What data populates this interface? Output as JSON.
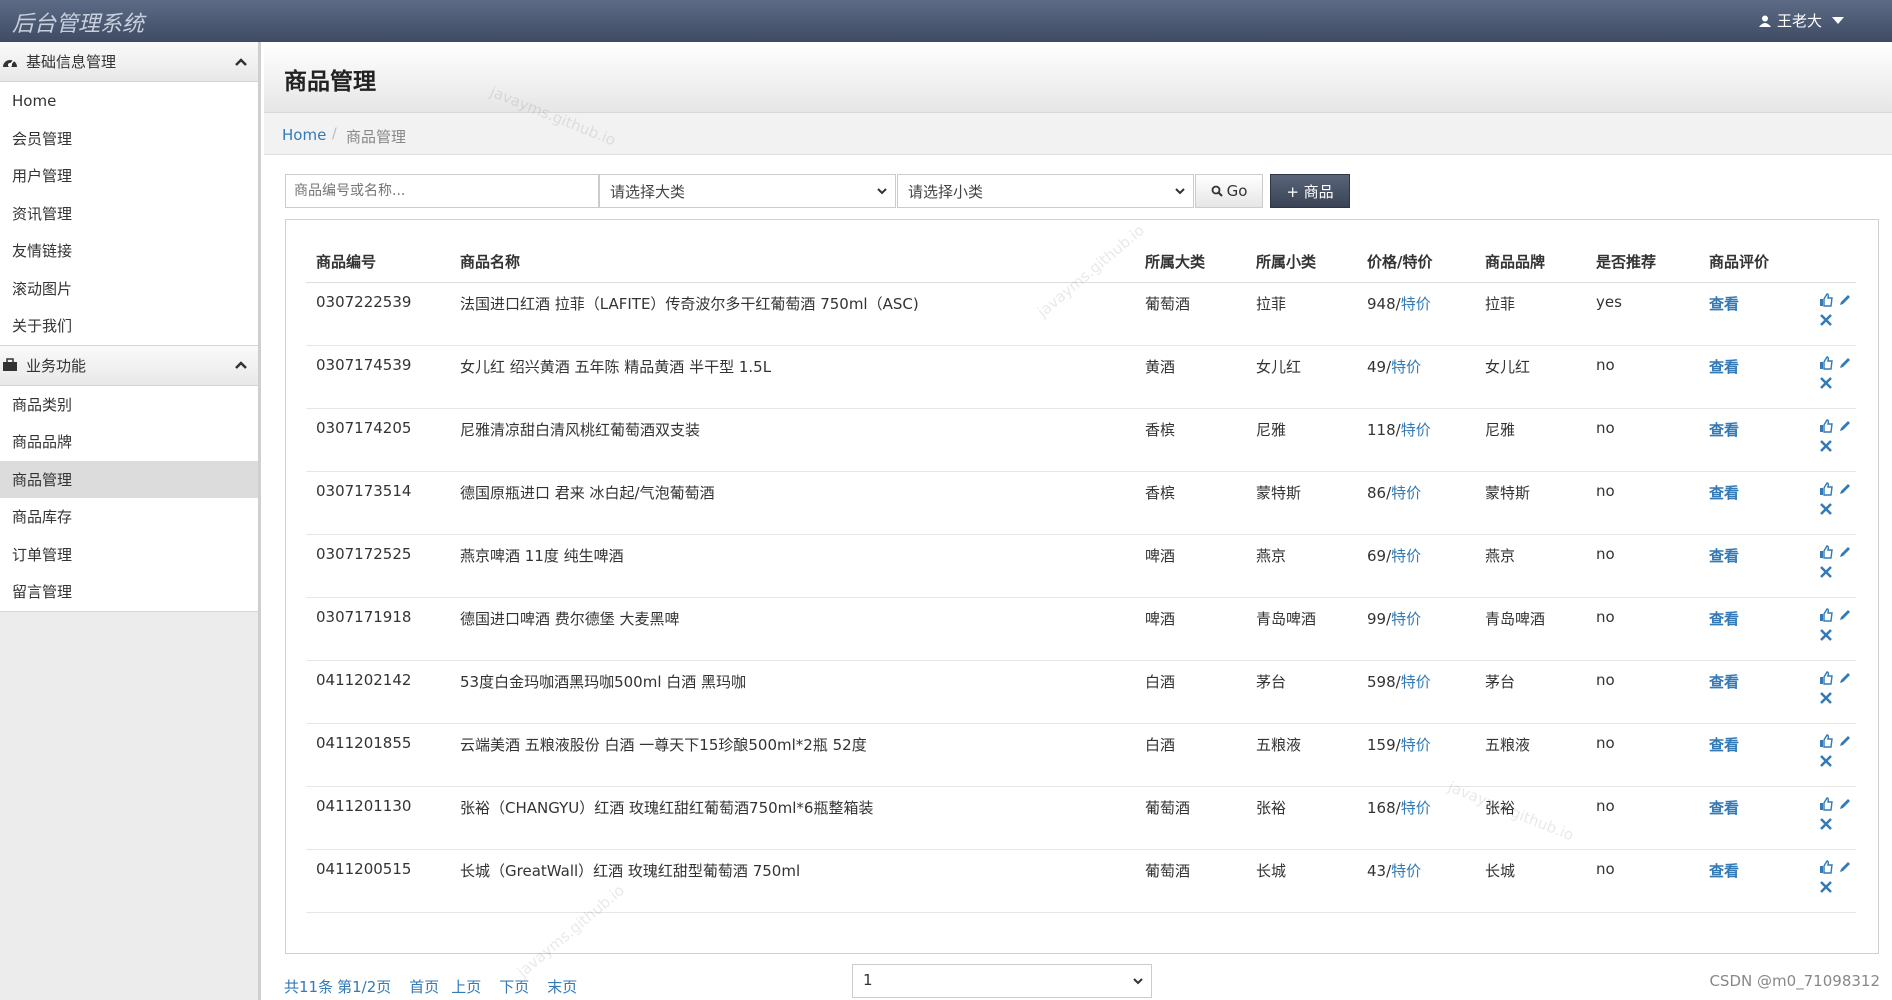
{
  "app": {
    "title": "后台管理系统",
    "user": "王老大"
  },
  "sidebar": {
    "sections": [
      {
        "title": "基础信息管理",
        "items": [
          "Home",
          "会员管理",
          "用户管理",
          "资讯管理",
          "友情链接",
          "滚动图片",
          "关于我们"
        ]
      },
      {
        "title": "业务功能",
        "items": [
          "商品类别",
          "商品品牌",
          "商品管理",
          "商品库存",
          "订单管理",
          "留言管理"
        ]
      }
    ]
  },
  "page": {
    "title": "商品管理",
    "breadcrumb": {
      "home": "Home",
      "current": "商品管理"
    }
  },
  "toolbar": {
    "search_placeholder": "商品编号或名称...",
    "category_select": "请选择大类",
    "subcategory_select": "请选择小类",
    "go_label": "Go",
    "add_label": "+ 商品"
  },
  "table": {
    "headers": [
      "商品编号",
      "商品名称",
      "所属大类",
      "所属小类",
      "价格/特价",
      "商品品牌",
      "是否推荐",
      "商品评价"
    ],
    "rows": [
      {
        "id": "0307222539",
        "name": "法国进口红酒 拉菲（LAFITE）传奇波尔多干红葡萄酒 750ml（ASC)",
        "cat": "葡萄酒",
        "sub": "拉菲",
        "price": "948/",
        "special": "特价",
        "brand": "拉菲",
        "rec": "yes",
        "eval": "查看"
      },
      {
        "id": "0307174539",
        "name": "女儿红 绍兴黄酒 五年陈 精品黄酒 半干型 1.5L",
        "cat": "黄酒",
        "sub": "女儿红",
        "price": "49/",
        "special": "特价",
        "brand": "女儿红",
        "rec": "no",
        "eval": "查看"
      },
      {
        "id": "0307174205",
        "name": "尼雅清凉甜白清风桃红葡萄酒双支装",
        "cat": "香槟",
        "sub": "尼雅",
        "price": "118/",
        "special": "特价",
        "brand": "尼雅",
        "rec": "no",
        "eval": "查看"
      },
      {
        "id": "0307173514",
        "name": "德国原瓶进口 君来 冰白起/气泡葡萄酒",
        "cat": "香槟",
        "sub": "蒙特斯",
        "price": "86/",
        "special": "特价",
        "brand": "蒙特斯",
        "rec": "no",
        "eval": "查看"
      },
      {
        "id": "0307172525",
        "name": "燕京啤酒 11度 纯生啤酒",
        "cat": "啤酒",
        "sub": "燕京",
        "price": "69/",
        "special": "特价",
        "brand": "燕京",
        "rec": "no",
        "eval": "查看"
      },
      {
        "id": "0307171918",
        "name": "德国进口啤酒 费尔德堡 大麦黑啤",
        "cat": "啤酒",
        "sub": "青岛啤酒",
        "price": "99/",
        "special": "特价",
        "brand": "青岛啤酒",
        "rec": "no",
        "eval": "查看"
      },
      {
        "id": "0411202142",
        "name": "53度白金玛咖酒黑玛咖500ml 白酒 黑玛咖",
        "cat": "白酒",
        "sub": "茅台",
        "price": "598/",
        "special": "特价",
        "brand": "茅台",
        "rec": "no",
        "eval": "查看"
      },
      {
        "id": "0411201855",
        "name": "云端美酒 五粮液股份 白酒 一尊天下15珍酿500ml*2瓶 52度",
        "cat": "白酒",
        "sub": "五粮液",
        "price": "159/",
        "special": "特价",
        "brand": "五粮液",
        "rec": "no",
        "eval": "查看"
      },
      {
        "id": "0411201130",
        "name": "张裕（CHANGYU）红酒 玫瑰红甜红葡萄酒750ml*6瓶整箱装",
        "cat": "葡萄酒",
        "sub": "张裕",
        "price": "168/",
        "special": "特价",
        "brand": "张裕",
        "rec": "no",
        "eval": "查看"
      },
      {
        "id": "0411200515",
        "name": "长城（GreatWall）红酒 玫瑰红甜型葡萄酒 750ml",
        "cat": "葡萄酒",
        "sub": "长城",
        "price": "43/",
        "special": "特价",
        "brand": "长城",
        "rec": "no",
        "eval": "查看"
      }
    ]
  },
  "pager": {
    "total": "共11条",
    "page": "第1/2页",
    "first": "首页",
    "prev": "上页",
    "next": "下页",
    "last": "末页",
    "jump_value": "1"
  },
  "watermark": "javayms.github.io",
  "footer_credit": "CSDN @m0_71098312"
}
